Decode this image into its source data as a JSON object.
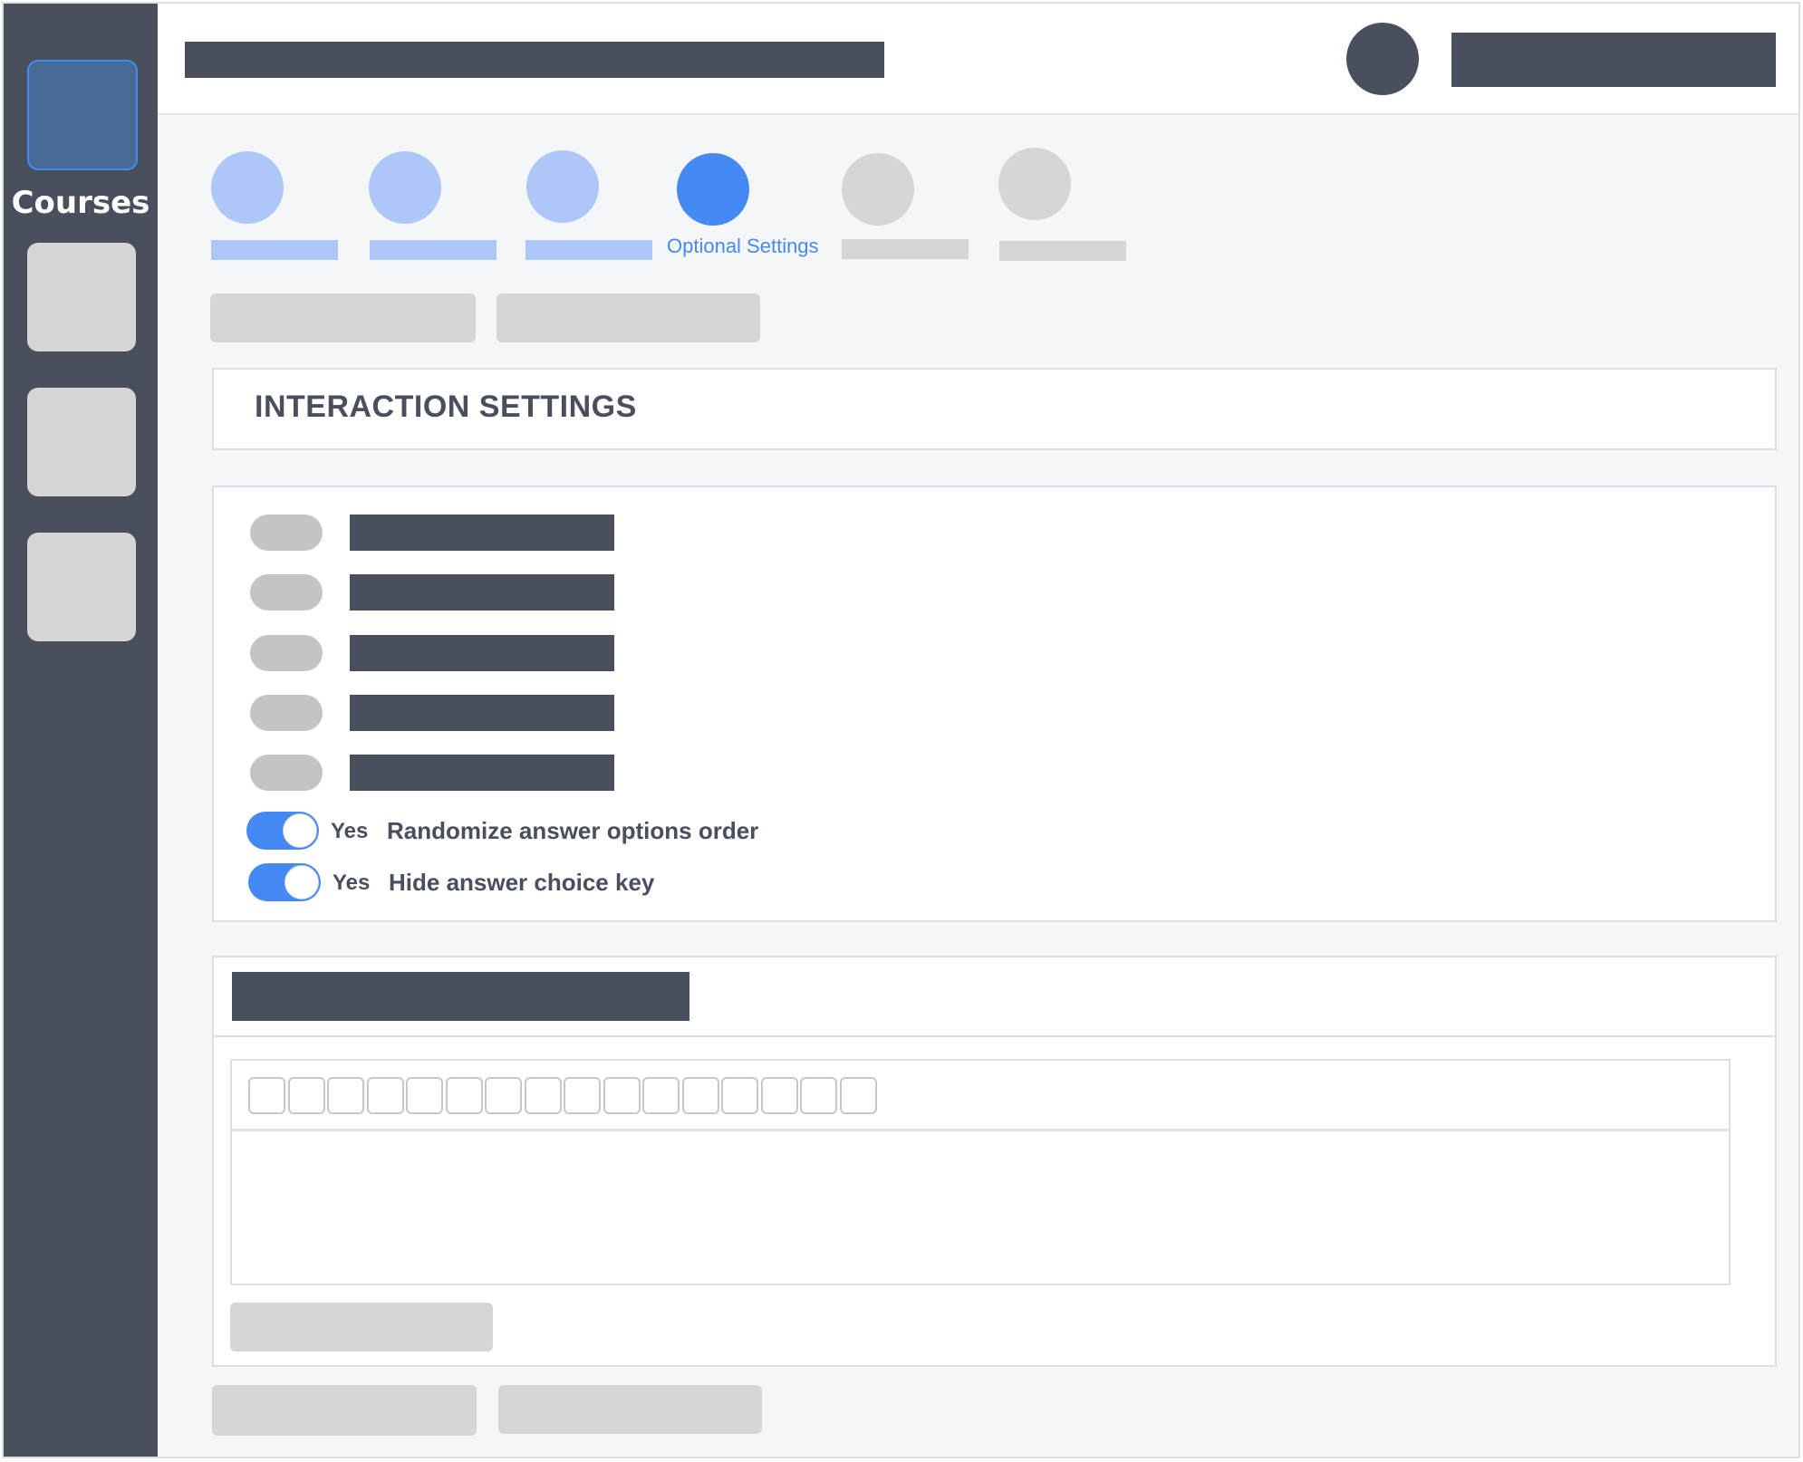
{
  "sidebar": {
    "active_label": "Courses"
  },
  "stepper": {
    "active_step_label": "Optional Settings"
  },
  "interaction_settings": {
    "title": "INTERACTION SETTINGS",
    "toggles": [
      {
        "state": "Yes",
        "label": "Randomize answer options order"
      },
      {
        "state": "Yes",
        "label": "Hide answer choice key"
      }
    ]
  },
  "editor": {
    "toolbar_button_count": 16
  },
  "colors": {
    "accent": "#4589f2",
    "accent_light": "#adc8f8",
    "dark": "#4a4f5e",
    "placeholder": "#d6d6d6"
  }
}
